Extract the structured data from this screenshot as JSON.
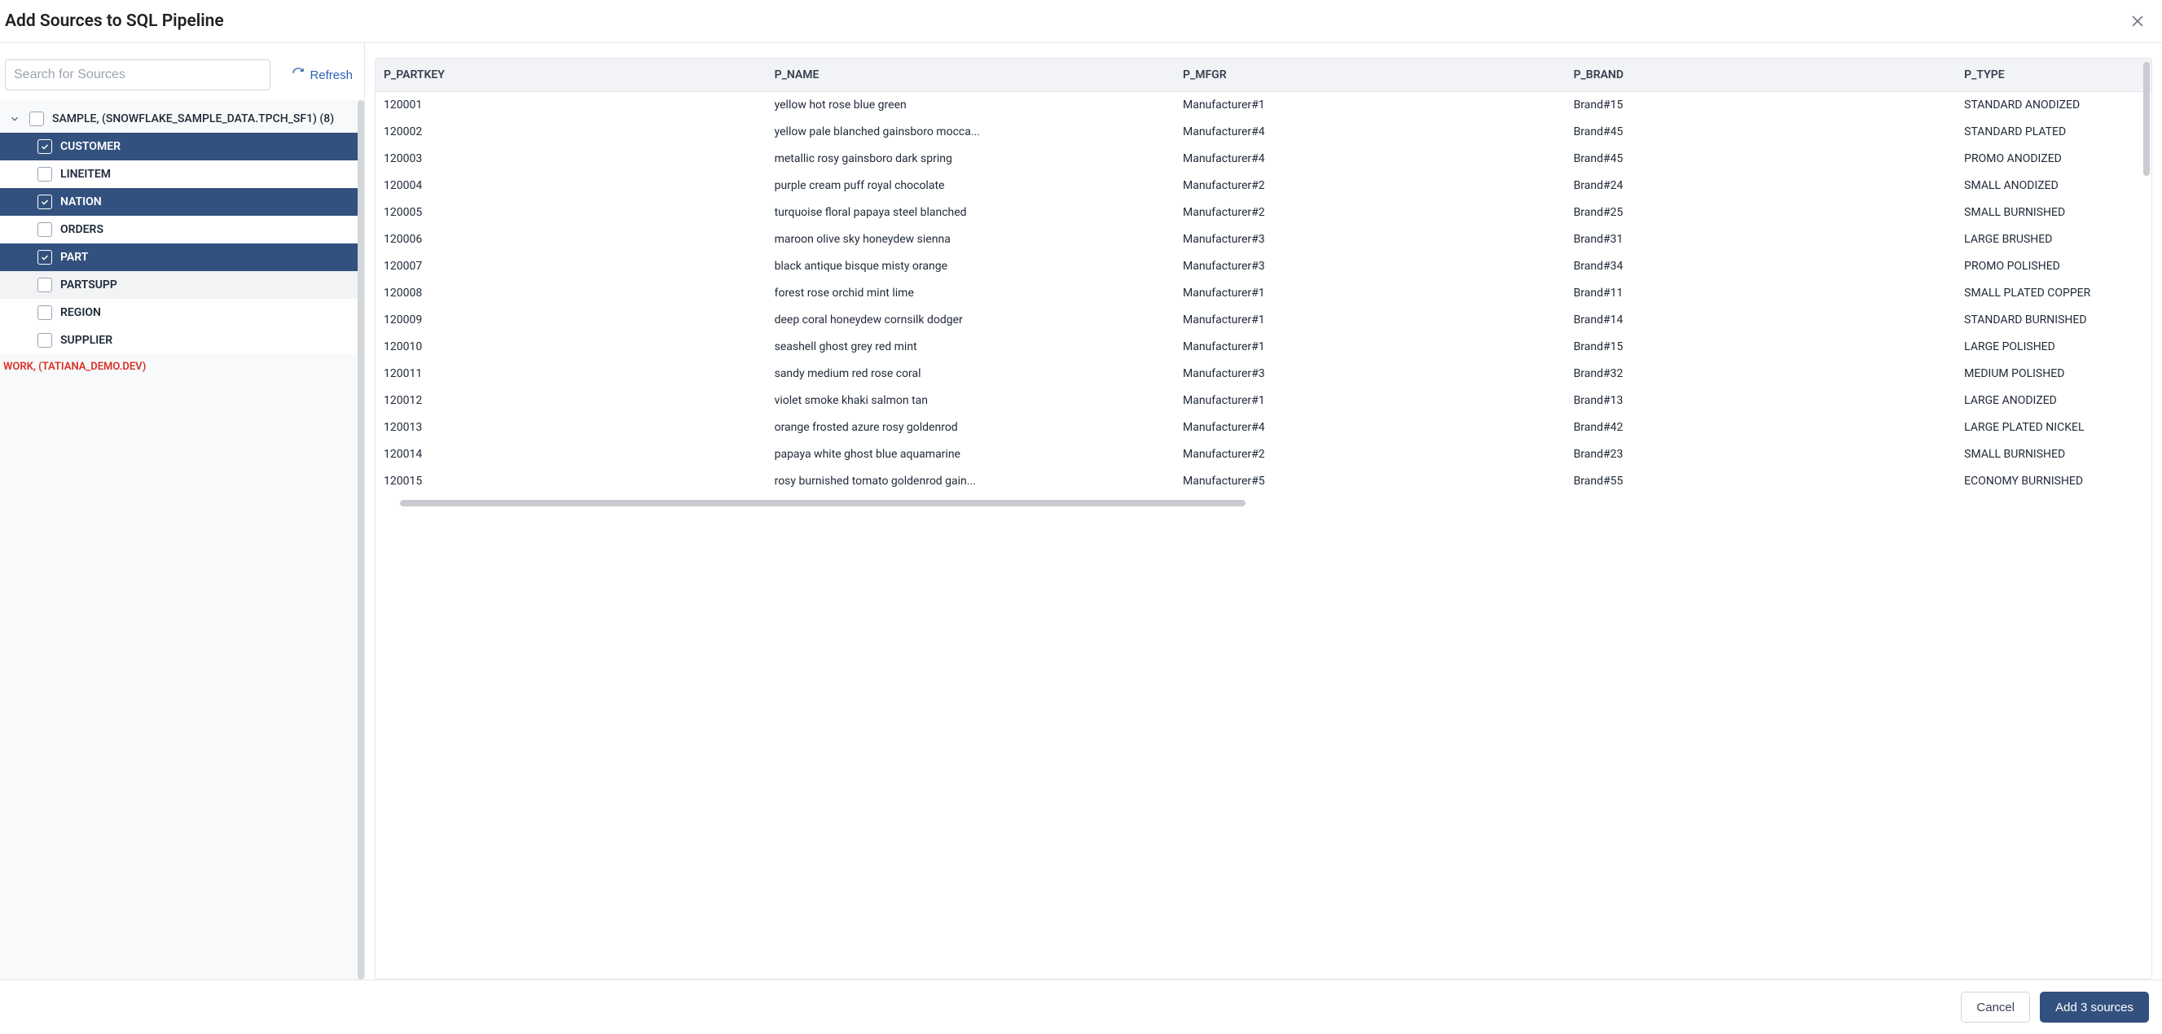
{
  "dialog": {
    "title": "Add Sources to SQL Pipeline",
    "search_placeholder": "Search for Sources",
    "refresh_label": "Refresh",
    "cancel_label": "Cancel",
    "submit_label": "Add 3 sources"
  },
  "tree": {
    "group_label": "SAMPLE, (SNOWFLAKE_SAMPLE_DATA.TPCH_SF1) (8)",
    "items": [
      {
        "label": "CUSTOMER",
        "selected": true
      },
      {
        "label": "LINEITEM",
        "selected": false
      },
      {
        "label": "NATION",
        "selected": true
      },
      {
        "label": "ORDERS",
        "selected": false
      },
      {
        "label": "PART",
        "selected": true
      },
      {
        "label": "PARTSUPP",
        "selected": false
      },
      {
        "label": "REGION",
        "selected": false
      },
      {
        "label": "SUPPLIER",
        "selected": false
      }
    ],
    "error_line": "WORK, (TATIANA_DEMO.DEV)"
  },
  "table": {
    "columns": [
      "P_PARTKEY",
      "P_NAME",
      "P_MFGR",
      "P_BRAND",
      "P_TYPE"
    ],
    "rows": [
      {
        "P_PARTKEY": "120001",
        "P_NAME": "yellow hot rose blue green",
        "P_MFGR": "Manufacturer#1",
        "P_BRAND": "Brand#15",
        "P_TYPE": "STANDARD ANODIZED"
      },
      {
        "P_PARTKEY": "120002",
        "P_NAME": "yellow pale blanched gainsboro mocca...",
        "P_MFGR": "Manufacturer#4",
        "P_BRAND": "Brand#45",
        "P_TYPE": "STANDARD PLATED"
      },
      {
        "P_PARTKEY": "120003",
        "P_NAME": "metallic rosy gainsboro dark spring",
        "P_MFGR": "Manufacturer#4",
        "P_BRAND": "Brand#45",
        "P_TYPE": "PROMO ANODIZED"
      },
      {
        "P_PARTKEY": "120004",
        "P_NAME": "purple cream puff royal chocolate",
        "P_MFGR": "Manufacturer#2",
        "P_BRAND": "Brand#24",
        "P_TYPE": "SMALL ANODIZED"
      },
      {
        "P_PARTKEY": "120005",
        "P_NAME": "turquoise floral papaya steel blanched",
        "P_MFGR": "Manufacturer#2",
        "P_BRAND": "Brand#25",
        "P_TYPE": "SMALL BURNISHED"
      },
      {
        "P_PARTKEY": "120006",
        "P_NAME": "maroon olive sky honeydew sienna",
        "P_MFGR": "Manufacturer#3",
        "P_BRAND": "Brand#31",
        "P_TYPE": "LARGE BRUSHED"
      },
      {
        "P_PARTKEY": "120007",
        "P_NAME": "black antique bisque misty orange",
        "P_MFGR": "Manufacturer#3",
        "P_BRAND": "Brand#34",
        "P_TYPE": "PROMO POLISHED"
      },
      {
        "P_PARTKEY": "120008",
        "P_NAME": "forest rose orchid mint lime",
        "P_MFGR": "Manufacturer#1",
        "P_BRAND": "Brand#11",
        "P_TYPE": "SMALL PLATED COPPER"
      },
      {
        "P_PARTKEY": "120009",
        "P_NAME": "deep coral honeydew cornsilk dodger",
        "P_MFGR": "Manufacturer#1",
        "P_BRAND": "Brand#14",
        "P_TYPE": "STANDARD BURNISHED"
      },
      {
        "P_PARTKEY": "120010",
        "P_NAME": "seashell ghost grey red mint",
        "P_MFGR": "Manufacturer#1",
        "P_BRAND": "Brand#15",
        "P_TYPE": "LARGE POLISHED"
      },
      {
        "P_PARTKEY": "120011",
        "P_NAME": "sandy medium red rose coral",
        "P_MFGR": "Manufacturer#3",
        "P_BRAND": "Brand#32",
        "P_TYPE": "MEDIUM POLISHED"
      },
      {
        "P_PARTKEY": "120012",
        "P_NAME": "violet smoke khaki salmon tan",
        "P_MFGR": "Manufacturer#1",
        "P_BRAND": "Brand#13",
        "P_TYPE": "LARGE ANODIZED"
      },
      {
        "P_PARTKEY": "120013",
        "P_NAME": "orange frosted azure rosy goldenrod",
        "P_MFGR": "Manufacturer#4",
        "P_BRAND": "Brand#42",
        "P_TYPE": "LARGE PLATED NICKEL"
      },
      {
        "P_PARTKEY": "120014",
        "P_NAME": "papaya white ghost blue aquamarine",
        "P_MFGR": "Manufacturer#2",
        "P_BRAND": "Brand#23",
        "P_TYPE": "SMALL BURNISHED"
      },
      {
        "P_PARTKEY": "120015",
        "P_NAME": "rosy burnished tomato goldenrod gain...",
        "P_MFGR": "Manufacturer#5",
        "P_BRAND": "Brand#55",
        "P_TYPE": "ECONOMY BURNISHED"
      }
    ]
  }
}
